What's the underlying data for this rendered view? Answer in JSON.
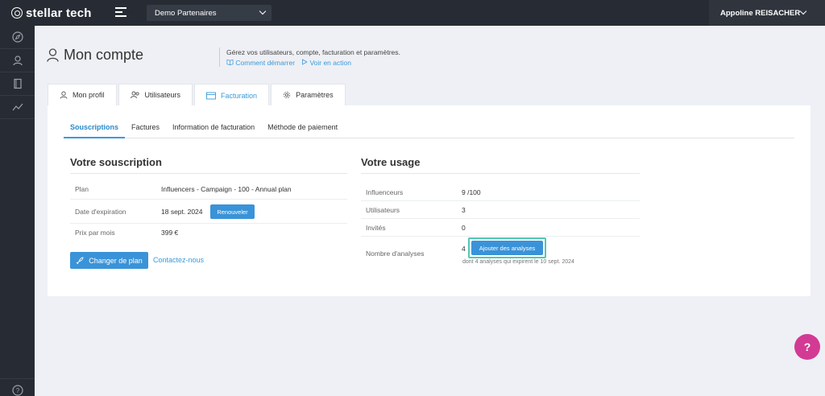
{
  "brand": {
    "name": "stellar tech"
  },
  "topbar": {
    "organization": "Demo Partenaires",
    "user_name": "Appoline REISACHER"
  },
  "sidebar": {
    "items": [
      "compass",
      "user",
      "book",
      "chart"
    ],
    "bottom": "help"
  },
  "header": {
    "title": "Mon compte",
    "description": "Gérez vos utilisateurs, compte, facturation et paramètres.",
    "link_start": "Comment démarrer",
    "link_video": "Voir en action"
  },
  "tabs": [
    {
      "label": "Mon profil",
      "icon": "user-icon"
    },
    {
      "label": "Utilisateurs",
      "icon": "users-icon"
    },
    {
      "label": "Facturation",
      "icon": "card-icon",
      "active": true
    },
    {
      "label": "Paramètres",
      "icon": "gear-icon"
    }
  ],
  "subtabs": [
    {
      "label": "Souscriptions",
      "active": true
    },
    {
      "label": "Factures"
    },
    {
      "label": "Information de facturation"
    },
    {
      "label": "Méthode de paiement"
    }
  ],
  "subscription": {
    "title": "Votre souscription",
    "plan_label": "Plan",
    "plan_value": "Influencers - Campaign - 100 - Annual plan",
    "expiry_label": "Date d'expiration",
    "expiry_value": "18 sept. 2024",
    "renew_button": "Renouveler",
    "price_label": "Prix par mois",
    "price_value": "399 €",
    "change_plan_button": "Changer de plan",
    "contact_link": "Contactez-nous"
  },
  "usage": {
    "title": "Votre usage",
    "influencers_label": "Influenceurs",
    "influencers_value": "9 /100",
    "users_label": "Utilisateurs",
    "users_value": "3",
    "guests_label": "Invités",
    "guests_value": "0",
    "analyses_label": "Nombre d'analyses",
    "analyses_value": "4",
    "add_analyses_button": "Ajouter des analyses",
    "analyses_note": "dont 4 analyses qui expirent le 10 sept. 2024"
  },
  "help_button": "?",
  "colors": {
    "accent": "#3a93d8",
    "highlight": "#4fc9b5",
    "help": "#d23a94",
    "dark": "#272c34"
  }
}
